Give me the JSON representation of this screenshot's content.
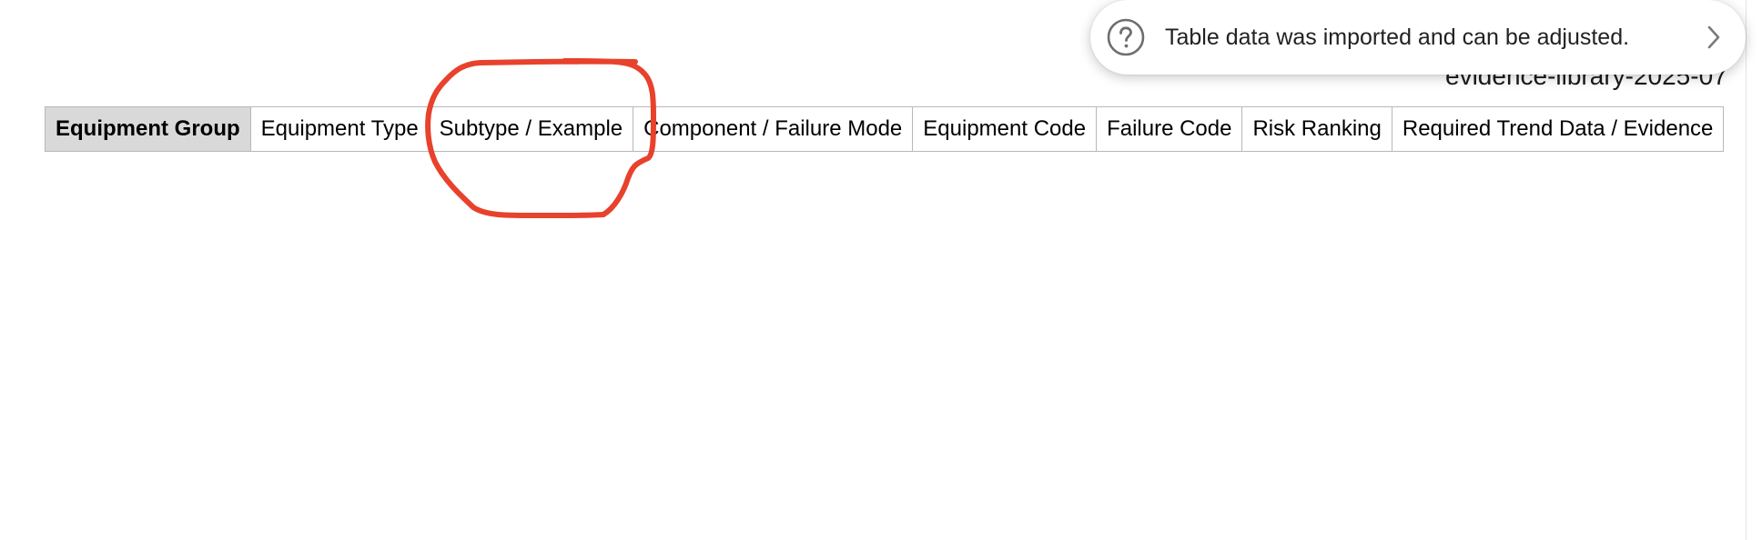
{
  "document": {
    "filename": "evidence-library-2025-07"
  },
  "table": {
    "headers": [
      "Equipment Group",
      "Equipment Type",
      "Subtype / Example",
      "Component / Failure Mode",
      "Equipment Code",
      "Failure Code",
      "Risk Ranking",
      "Required Trend Data / Evidence"
    ]
  },
  "toast": {
    "message": "Table data was imported and can be adjusted.",
    "icon": "help-icon",
    "action_icon": "chevron-right-icon"
  },
  "annotation": {
    "color": "#e8412c",
    "shape": "hand-drawn-circle"
  }
}
